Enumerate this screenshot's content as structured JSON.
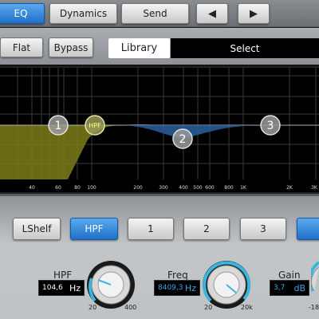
{
  "top_tabs": {
    "eq": "EQ",
    "dynamics": "Dynamics",
    "send": "Send",
    "prev": "◀",
    "next": "▶"
  },
  "preset_bar": {
    "flat": "Flat",
    "bypass": "Bypass",
    "library": "Library",
    "select": "Select"
  },
  "graph": {
    "freq_labels": [
      "40",
      "60",
      "80",
      "100",
      "200",
      "300",
      "400",
      "500",
      "600",
      "800",
      "1K",
      "2K",
      "3K"
    ],
    "nodes": [
      {
        "label": "1"
      },
      {
        "label": "HPF"
      },
      {
        "label": "2"
      },
      {
        "label": "3"
      }
    ]
  },
  "band_buttons": {
    "lshelf": "LShelf",
    "hpf": "HPF",
    "band1": "1",
    "band2": "2",
    "band3": "3"
  },
  "controls": {
    "hpf": {
      "label": "HPF",
      "value": "104,6",
      "unit": "Hz",
      "min": "20",
      "max": "400"
    },
    "freq": {
      "label": "Freq",
      "value": "8409,3",
      "unit": "Hz",
      "min": "20",
      "max": "20k"
    },
    "gain": {
      "label": "Gain",
      "value": "3,7",
      "unit": "dB",
      "min": "-18"
    }
  },
  "colors": {
    "active_blue": "#1f6fc8",
    "hpf_curve": "#7d7c1a",
    "band2_curve": "#2a5f9e",
    "value_blue": "#3aa7e6"
  }
}
